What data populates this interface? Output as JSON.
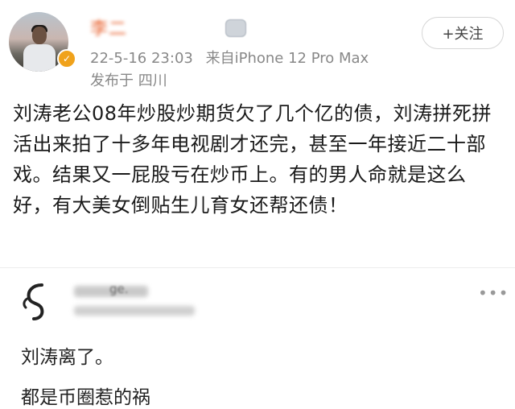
{
  "post": {
    "username": "李二",
    "timestamp": "22-5-16 23:03",
    "source": "来自iPhone 12 Pro Max",
    "location": "发布于 四川",
    "follow_label": "+关注",
    "text": "刘涛老公08年炒股炒期货欠了几个亿的债，刘涛拼死拼活出来拍了十多年电视剧才还完，甚至一年接近二十部戏。结果又一屁股亏在炒币上。有的男人命就是这么好，有大美女倒贴生儿育女还帮还债！"
  },
  "comment": {
    "name_suffix": "ge.",
    "text": "刘涛离了。",
    "text2": "都是币圈惹的祸"
  },
  "colors": {
    "username": "#e8612e",
    "meta": "#888888",
    "verified": "#f0a21b"
  },
  "icons": {
    "verified": "verified-badge-icon",
    "more": "more-dots-icon"
  }
}
